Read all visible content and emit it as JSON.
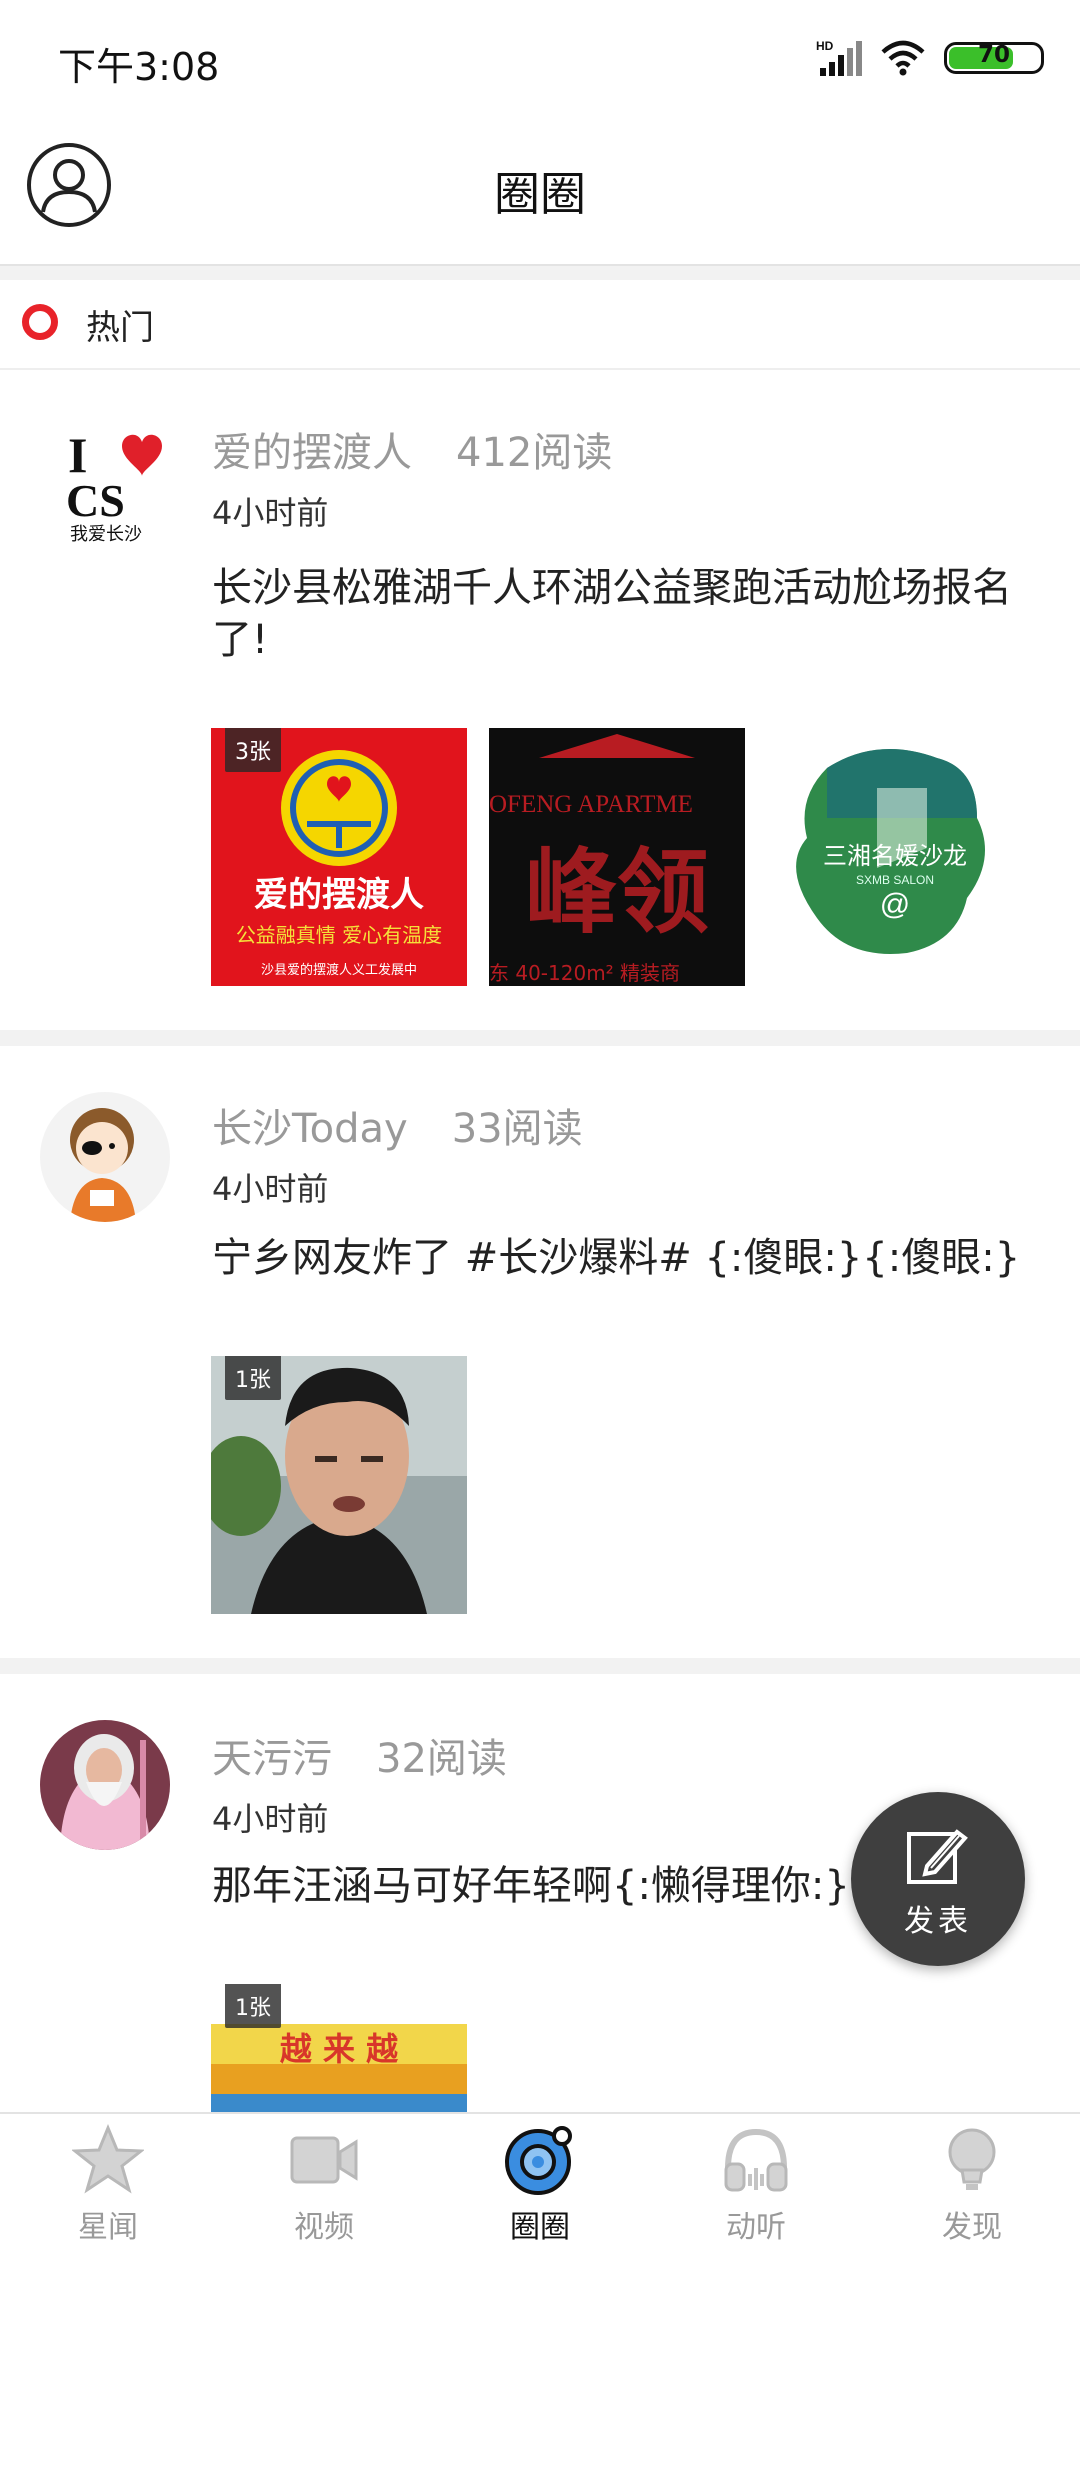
{
  "status_bar": {
    "time": "下午3:08",
    "battery": "70",
    "network": "HD"
  },
  "header": {
    "title": "圈圈"
  },
  "section": {
    "label": "热门"
  },
  "posts": [
    {
      "author": "爱的摆渡人",
      "reads": "412阅读",
      "time": "4小时前",
      "text": "长沙县松雅湖千人环湖公益聚跑活动尬场报名了!",
      "image_count": "3张",
      "avatar_text": {
        "top": "I",
        "middle": "CS",
        "bottom": "我爱长沙"
      },
      "images": [
        {
          "title": "爱的摆渡人",
          "line1": "公益融真情  爱心有温度",
          "line2": "沙县爱的摆渡人义工发展中"
        },
        {
          "top": "OFENG APARTME",
          "main": "峰领",
          "bottom": "东 40-120m² 精装商"
        },
        {
          "main": "三湘名媛沙龙",
          "sub": "SXMB SALON",
          "at": "@"
        }
      ]
    },
    {
      "author": "长沙Today",
      "reads": "33阅读",
      "time": "4小时前",
      "text": "宁乡网友炸了 #长沙爆料# {:傻眼:}{:傻眼:}",
      "image_count": "1张"
    },
    {
      "author": "天污污",
      "reads": "32阅读",
      "time": "4小时前",
      "text": "那年汪涵马可好年轻啊{:懒得理你:}",
      "image_count": "1张",
      "image_text": "越 来 越"
    }
  ],
  "fab": {
    "label": "发表"
  },
  "nav": [
    {
      "label": "星闻",
      "icon": "star-icon"
    },
    {
      "label": "视频",
      "icon": "video-icon"
    },
    {
      "label": "圈圈",
      "icon": "circle-icon",
      "active": true
    },
    {
      "label": "动听",
      "icon": "headphones-icon"
    },
    {
      "label": "发现",
      "icon": "lightbulb-icon"
    }
  ],
  "colors": {
    "accent": "#e8232a",
    "fab": "#3f3f3f",
    "inactive": "#999999",
    "circle_icon": "#3a8de0"
  }
}
